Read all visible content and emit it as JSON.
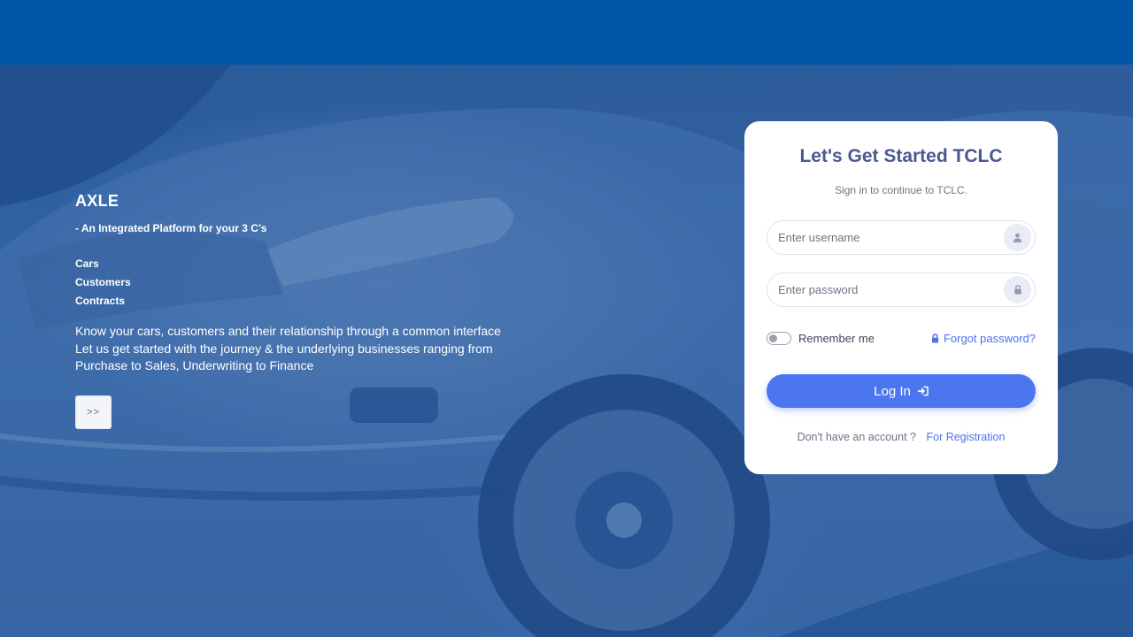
{
  "colors": {
    "topbar": "#0155a7",
    "accent": "#4b76ef",
    "title": "#4a5a91"
  },
  "hero": {
    "brand": "AXLE",
    "tagline": "- An Integrated Platform for your 3 C’s",
    "items": [
      "Cars",
      "Customers",
      "Contracts"
    ],
    "description": [
      "Know your cars, customers and their relationship through a common interface",
      "Let us get started with the journey & the underlying businesses ranging from",
      "Purchase to Sales, Underwriting to Finance"
    ],
    "next_label": ">>"
  },
  "login": {
    "title": "Let's Get Started TCLC",
    "subtitle": "Sign in to continue to TCLC.",
    "username_placeholder": "Enter username",
    "password_placeholder": "Enter password",
    "remember_label": "Remember me",
    "forgot_label": "Forgot password?",
    "login_label": "Log In",
    "no_account_text": "Don't have an account ?",
    "register_label": "For Registration",
    "username_icon": "user-icon",
    "password_icon": "lock-icon"
  }
}
